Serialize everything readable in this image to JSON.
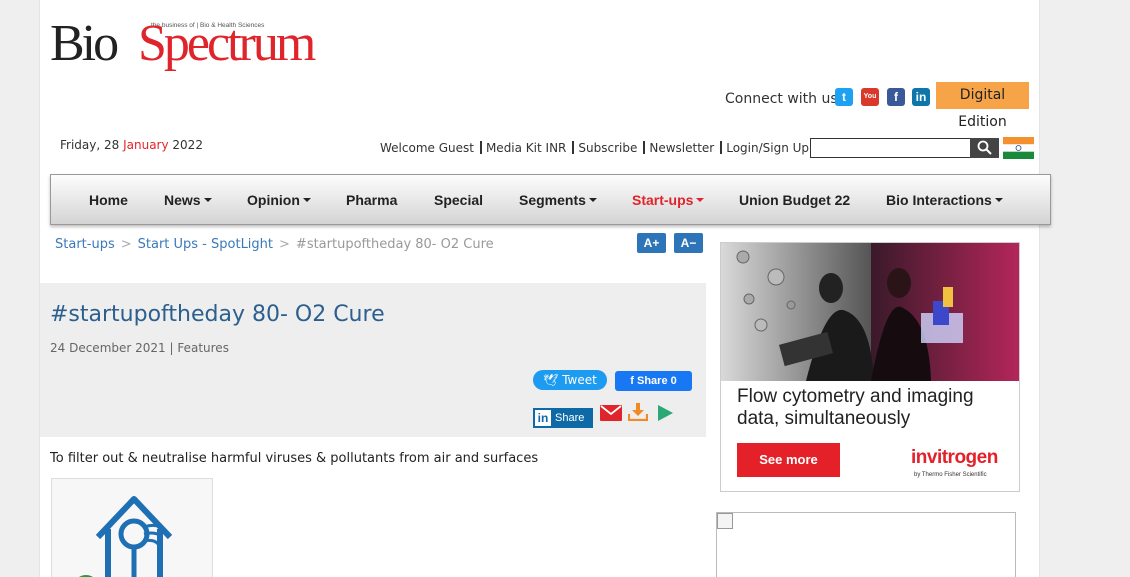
{
  "logo": {
    "tagline": "the business of | Bio & Health Sciences",
    "bio": "Bio",
    "spectrum": "Spectrum"
  },
  "header": {
    "connect_label": "Connect with us :",
    "social": [
      {
        "icon": "twitter-icon",
        "color": "#1da1f2"
      },
      {
        "icon": "youtube-icon",
        "color": "#d8392b"
      },
      {
        "icon": "facebook-icon",
        "color": "#3b5998"
      },
      {
        "icon": "linkedin-icon",
        "color": "#0e76a8"
      }
    ],
    "digital_edition": "Digital Edition",
    "date_prefix": "Friday, 28 ",
    "date_month": "January",
    "date_year": " 2022",
    "links": [
      "Welcome Guest",
      "Media Kit INR",
      "Subscribe",
      "Newsletter",
      "Login/Sign Up"
    ],
    "search_placeholder": ""
  },
  "nav": {
    "items": [
      {
        "label": "Home",
        "dropdown": false
      },
      {
        "label": "News",
        "dropdown": true
      },
      {
        "label": "Opinion",
        "dropdown": true
      },
      {
        "label": "Pharma",
        "dropdown": false
      },
      {
        "label": "Special",
        "dropdown": false
      },
      {
        "label": "Segments",
        "dropdown": true
      },
      {
        "label": "Start-ups",
        "dropdown": true,
        "active": true
      },
      {
        "label": "Union Budget 22",
        "dropdown": false
      },
      {
        "label": "Bio Interactions",
        "dropdown": true
      }
    ],
    "active_color": "#e0242b"
  },
  "breadcrumb": {
    "items": [
      "Start-ups",
      "Start Ups - SpotLight",
      "#startupoftheday 80- O2 Cure"
    ],
    "separator": ">"
  },
  "font_controls": {
    "increase": "A+",
    "decrease": "A−"
  },
  "article": {
    "title": "#startupoftheday 80- O2 Cure",
    "date": "24 December 2021",
    "category": "Features",
    "summary": "To filter out & neutralise harmful viruses & pollutants from air and surfaces"
  },
  "share": {
    "tweet": "Tweet",
    "fb": "Share 0",
    "linkedin": "Share"
  },
  "ad": {
    "headline_1": "Flow cytometry and imaging",
    "headline_2": "data, simultaneously",
    "cta": "See more",
    "brand": "invitrogen",
    "brand_sub": "by Thermo Fisher Scientific"
  }
}
